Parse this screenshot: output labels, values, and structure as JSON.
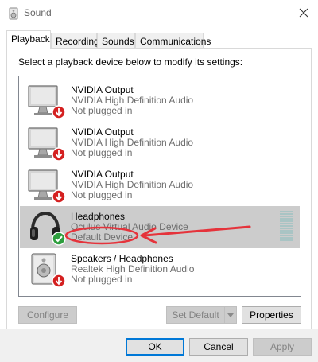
{
  "window": {
    "title": "Sound",
    "icon": "speaker-icon",
    "close_icon": "close-icon"
  },
  "tabs": [
    {
      "label": "Playback",
      "active": true
    },
    {
      "label": "Recording",
      "active": false
    },
    {
      "label": "Sounds",
      "active": false
    },
    {
      "label": "Communications",
      "active": false
    }
  ],
  "instruction": "Select a playback device below to modify its settings:",
  "devices": [
    {
      "name": "NVIDIA Output",
      "description": "NVIDIA High Definition Audio",
      "status": "Not plugged in",
      "icon": "monitor-icon",
      "badge": "unplugged-badge-icon",
      "selected": false
    },
    {
      "name": "NVIDIA Output",
      "description": "NVIDIA High Definition Audio",
      "status": "Not plugged in",
      "icon": "monitor-icon",
      "badge": "unplugged-badge-icon",
      "selected": false
    },
    {
      "name": "NVIDIA Output",
      "description": "NVIDIA High Definition Audio",
      "status": "Not plugged in",
      "icon": "monitor-icon",
      "badge": "unplugged-badge-icon",
      "selected": false
    },
    {
      "name": "Headphones",
      "description": "Oculus Virtual Audio Device",
      "status": "Default Device",
      "icon": "headphones-icon",
      "badge": "default-check-badge-icon",
      "selected": true
    },
    {
      "name": "Speakers / Headphones",
      "description": "Realtek High Definition Audio",
      "status": "Not plugged in",
      "icon": "speaker-box-icon",
      "badge": "unplugged-badge-icon",
      "selected": false
    }
  ],
  "buttons": {
    "configure": "Configure",
    "set_default": "Set Default",
    "properties": "Properties",
    "ok": "OK",
    "cancel": "Cancel",
    "apply": "Apply"
  },
  "colors": {
    "selection": "#cccccc",
    "unplugged_badge": "#d42020",
    "default_badge": "#2e9e3e",
    "annotation": "#e5333b",
    "focus_border": "#0078d7"
  }
}
